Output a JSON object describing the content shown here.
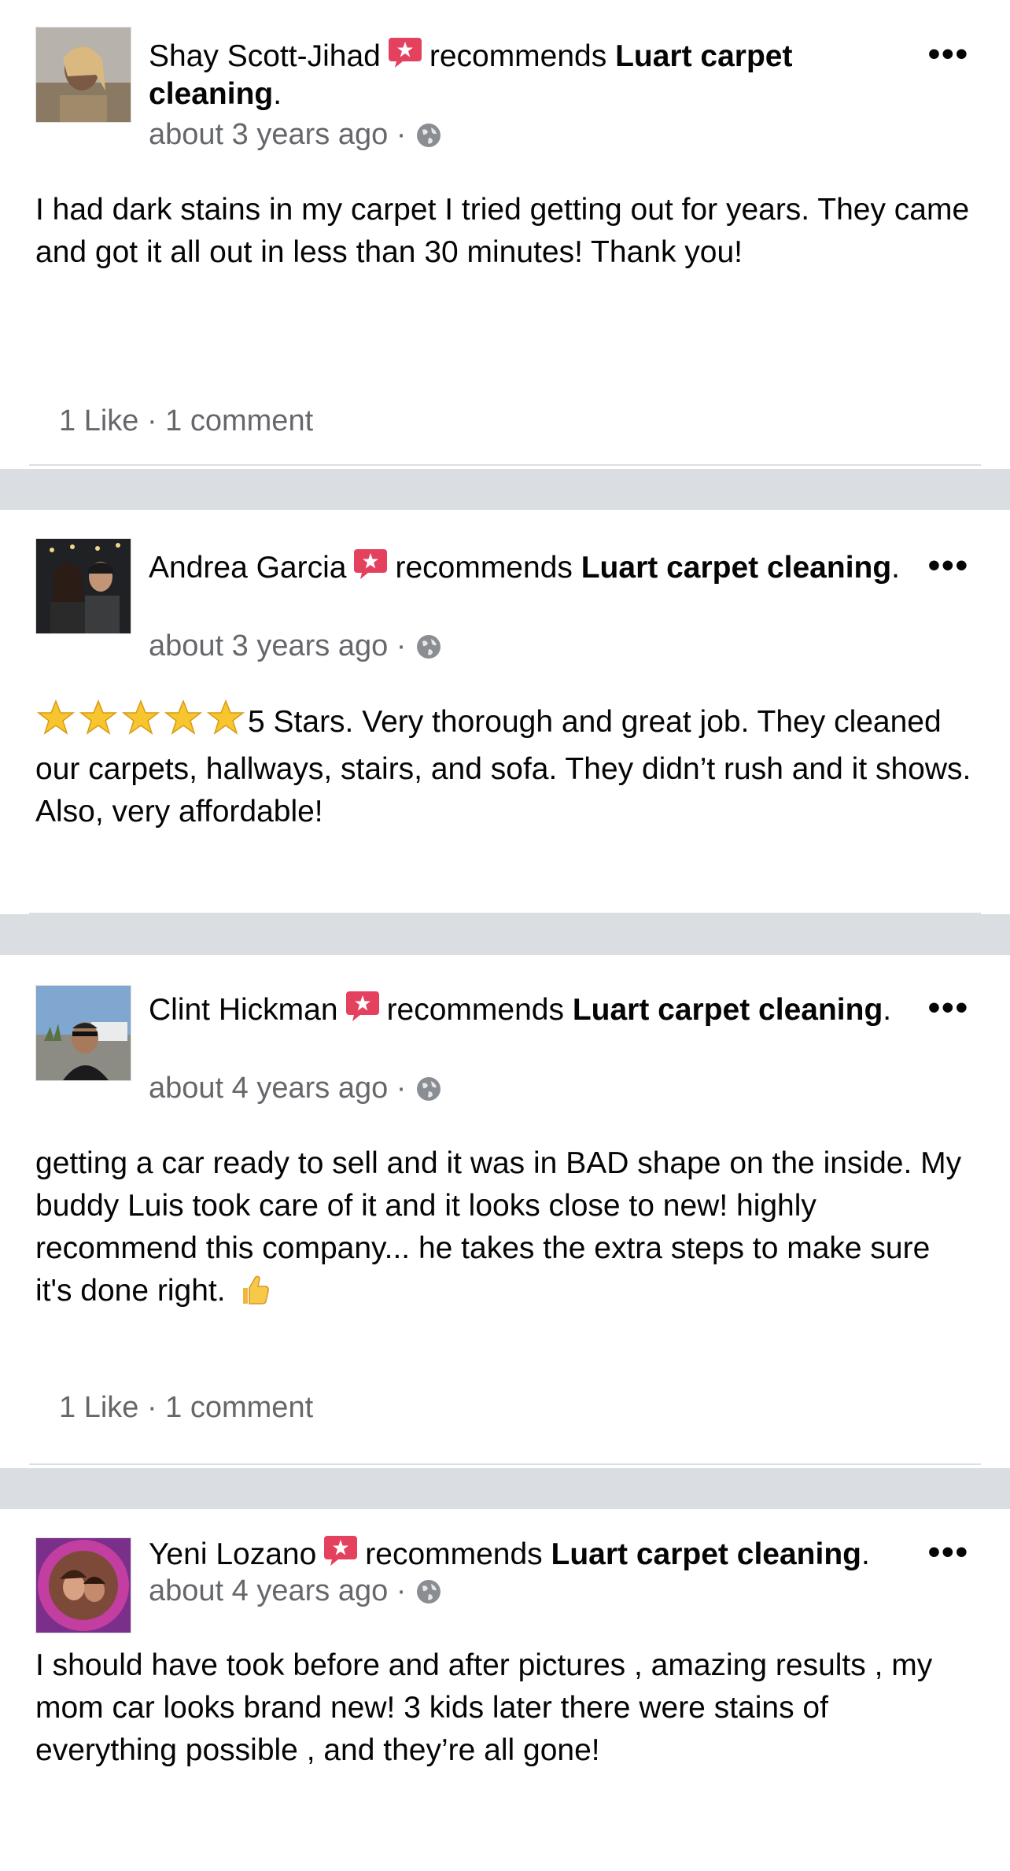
{
  "colors": {
    "badge": "#e4415f",
    "meta": "#65676b",
    "separator": "#dadde1"
  },
  "icons": {
    "badge": "recommendation-star-icon",
    "privacy": "globe-icon",
    "more": "more-horizontal-icon",
    "stars": "star-icon",
    "thumb": "thumbs-up-emoji"
  },
  "posts": [
    {
      "author": "Shay Scott-Jihad",
      "verb": "recommends",
      "page": "Luart carpet cleaning",
      "punct": ".",
      "time": "about 3 years ago",
      "dot": "·",
      "more": "•••",
      "text": "I had dark stains in my carpet I tried getting out for years. They came and got it all out in less than 30 minutes! Thank you!",
      "counts": "1 Like · 1 comment"
    },
    {
      "author": "Andrea Garcia",
      "verb": "recommends",
      "page": "Luart carpet cleaning",
      "punct": ".",
      "time": "about 3 years ago",
      "dot": "·",
      "more": "•••",
      "rating_stars": 5,
      "text": "5 Stars. Very thorough and great job. They cleaned our carpets, hallways, stairs, and sofa. They didn’t rush and it shows. Also, very affordable!"
    },
    {
      "author": "Clint Hickman",
      "verb": "recommends",
      "page": "Luart carpet cleaning",
      "punct": ".",
      "time": "about 4 years ago",
      "dot": "·",
      "more": "•••",
      "text": "getting a car ready to sell and it was in BAD shape on the inside. My buddy Luis took care of it and it looks close to new! highly recommend this company... he takes the extra steps to make sure it's done right.",
      "counts": "1 Like · 1 comment"
    },
    {
      "author": "Yeni Lozano",
      "verb": "recommends",
      "page": "Luart carpet cleaning",
      "punct": ".",
      "time": "about 4 years ago",
      "dot": "·",
      "more": "•••",
      "text": "I should have took before and after pictures , amazing results , my mom car looks brand new! 3 kids later there were stains of everything possible , and they’re all gone!"
    }
  ]
}
